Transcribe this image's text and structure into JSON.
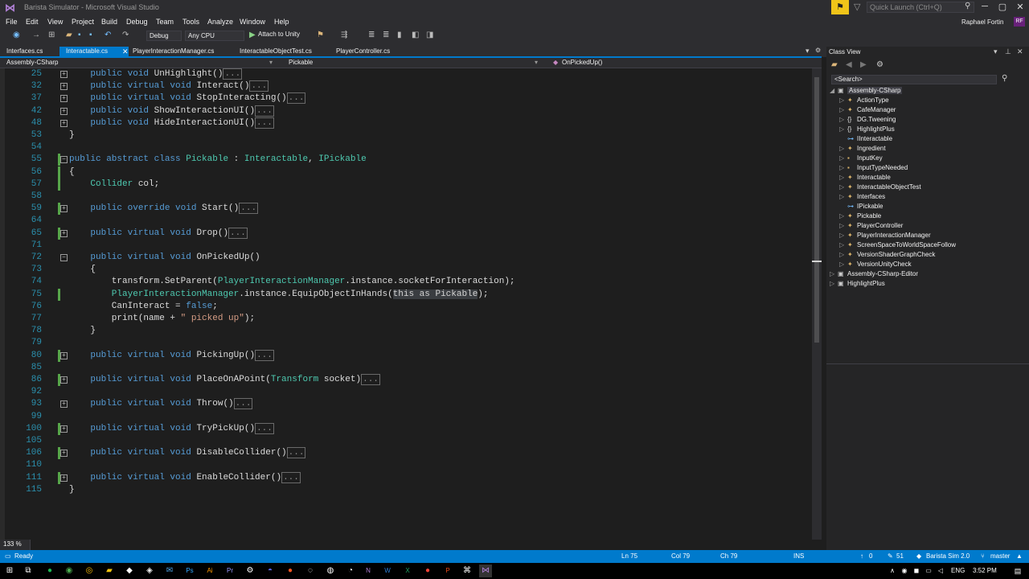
{
  "window": {
    "title": "Barista Simulator - Microsoft Visual Studio",
    "quick_launch_placeholder": "Quick Launch (Ctrl+Q)",
    "user": "Raphael Fortin",
    "avatar": "RF"
  },
  "menu": [
    "File",
    "Edit",
    "View",
    "Project",
    "Build",
    "Debug",
    "Team",
    "Tools",
    "Analyze",
    "Window",
    "Help"
  ],
  "toolbar": {
    "config": "Debug",
    "platform": "Any CPU",
    "attach": "Attach to Unity"
  },
  "tabs": [
    "Interfaces.cs",
    "Interactable.cs",
    "PlayerInteractionManager.cs",
    "InteractableObjectTest.cs",
    "PlayerController.cs"
  ],
  "nav": {
    "project": "Assembly-CSharp",
    "class": "Pickable",
    "member": "OnPickedUp()"
  },
  "code": [
    {
      "n": "25",
      "fold": true,
      "chg": "",
      "tokens": [
        [
          "k",
          "    public void "
        ],
        [
          "p",
          "UnHighlight()"
        ],
        [
          "col",
          "..."
        ]
      ]
    },
    {
      "n": "32",
      "fold": true,
      "chg": "",
      "tokens": [
        [
          "k",
          "    public virtual void "
        ],
        [
          "p",
          "Interact()"
        ],
        [
          "col",
          "..."
        ]
      ]
    },
    {
      "n": "37",
      "fold": true,
      "chg": "",
      "tokens": [
        [
          "k",
          "    public virtual void "
        ],
        [
          "p",
          "StopInteracting()"
        ],
        [
          "col",
          "..."
        ]
      ]
    },
    {
      "n": "42",
      "fold": true,
      "chg": "",
      "tokens": [
        [
          "k",
          "    public void "
        ],
        [
          "p",
          "ShowInteractionUI()"
        ],
        [
          "col",
          "..."
        ]
      ]
    },
    {
      "n": "48",
      "fold": true,
      "chg": "",
      "tokens": [
        [
          "k",
          "    public void "
        ],
        [
          "p",
          "HideInteractionUI()"
        ],
        [
          "col",
          "..."
        ]
      ]
    },
    {
      "n": "53",
      "fold": false,
      "chg": "",
      "tokens": [
        [
          "p",
          "}"
        ]
      ]
    },
    {
      "n": "54",
      "fold": false,
      "chg": "",
      "tokens": []
    },
    {
      "n": "55",
      "fold": true,
      "chg": "g",
      "tokens": [
        [
          "k",
          "public abstract class "
        ],
        [
          "t",
          "Pickable"
        ],
        [
          "p",
          " : "
        ],
        [
          "t",
          "Interactable"
        ],
        [
          "p",
          ", "
        ],
        [
          "t",
          "IPickable"
        ]
      ]
    },
    {
      "n": "56",
      "fold": false,
      "chg": "g",
      "tokens": [
        [
          "p",
          "{"
        ]
      ]
    },
    {
      "n": "57",
      "fold": false,
      "chg": "g",
      "tokens": [
        [
          "t",
          "    Collider"
        ],
        [
          "p",
          " col;"
        ]
      ]
    },
    {
      "n": "58",
      "fold": false,
      "chg": "",
      "tokens": []
    },
    {
      "n": "59",
      "fold": true,
      "chg": "g",
      "tokens": [
        [
          "k",
          "    public override void "
        ],
        [
          "p",
          "Start()"
        ],
        [
          "col",
          "..."
        ]
      ]
    },
    {
      "n": "64",
      "fold": false,
      "chg": "",
      "tokens": []
    },
    {
      "n": "65",
      "fold": true,
      "chg": "g",
      "tokens": [
        [
          "k",
          "    public virtual void "
        ],
        [
          "p",
          "Drop()"
        ],
        [
          "col",
          "..."
        ]
      ]
    },
    {
      "n": "71",
      "fold": false,
      "chg": "",
      "tokens": []
    },
    {
      "n": "72",
      "fold": true,
      "chg": "",
      "tokens": [
        [
          "k",
          "    public virtual void "
        ],
        [
          "p",
          "OnPickedUp()"
        ]
      ]
    },
    {
      "n": "73",
      "fold": false,
      "chg": "",
      "tokens": [
        [
          "p",
          "    {"
        ]
      ]
    },
    {
      "n": "74",
      "fold": false,
      "chg": "",
      "tokens": [
        [
          "p",
          "        transform.SetParent("
        ],
        [
          "t",
          "PlayerInteractionManager"
        ],
        [
          "p",
          ".instance.socketForInteraction);"
        ]
      ]
    },
    {
      "n": "75",
      "fold": false,
      "chg": "g",
      "tokens": [
        [
          "t",
          "        PlayerInteractionManager"
        ],
        [
          "p",
          ".instance.EquipObjectInHands("
        ],
        [
          "sel",
          "this as Pickable"
        ],
        [
          "p",
          ");"
        ]
      ]
    },
    {
      "n": "76",
      "fold": false,
      "chg": "",
      "tokens": [
        [
          "p",
          "        CanInteract = "
        ],
        [
          "k",
          "false"
        ],
        [
          "p",
          ";"
        ]
      ]
    },
    {
      "n": "77",
      "fold": false,
      "chg": "",
      "tokens": [
        [
          "p",
          "        print(name + "
        ],
        [
          "s",
          "\" picked up\""
        ],
        [
          "p",
          ");"
        ]
      ]
    },
    {
      "n": "78",
      "fold": false,
      "chg": "",
      "tokens": [
        [
          "p",
          "    }"
        ]
      ]
    },
    {
      "n": "79",
      "fold": false,
      "chg": "",
      "tokens": []
    },
    {
      "n": "80",
      "fold": true,
      "chg": "g",
      "tokens": [
        [
          "k",
          "    public virtual void "
        ],
        [
          "p",
          "PickingUp()"
        ],
        [
          "col",
          "..."
        ]
      ]
    },
    {
      "n": "85",
      "fold": false,
      "chg": "",
      "tokens": []
    },
    {
      "n": "86",
      "fold": true,
      "chg": "g",
      "tokens": [
        [
          "k",
          "    public virtual void "
        ],
        [
          "p",
          "PlaceOnAPoint("
        ],
        [
          "t",
          "Transform"
        ],
        [
          "p",
          " socket)"
        ],
        [
          "col",
          "..."
        ]
      ]
    },
    {
      "n": "92",
      "fold": false,
      "chg": "",
      "tokens": []
    },
    {
      "n": "93",
      "fold": true,
      "chg": "",
      "tokens": [
        [
          "k",
          "    public virtual void "
        ],
        [
          "p",
          "Throw()"
        ],
        [
          "col",
          "..."
        ]
      ]
    },
    {
      "n": "99",
      "fold": false,
      "chg": "",
      "tokens": []
    },
    {
      "n": "100",
      "fold": true,
      "chg": "g",
      "tokens": [
        [
          "k",
          "    public virtual void "
        ],
        [
          "p",
          "TryPickUp()"
        ],
        [
          "col",
          "..."
        ]
      ]
    },
    {
      "n": "105",
      "fold": false,
      "chg": "",
      "tokens": []
    },
    {
      "n": "106",
      "fold": true,
      "chg": "g",
      "tokens": [
        [
          "k",
          "    public virtual void "
        ],
        [
          "p",
          "DisableCollider()"
        ],
        [
          "col",
          "..."
        ]
      ]
    },
    {
      "n": "110",
      "fold": false,
      "chg": "",
      "tokens": []
    },
    {
      "n": "111",
      "fold": true,
      "chg": "g",
      "tokens": [
        [
          "k",
          "    public virtual void "
        ],
        [
          "p",
          "EnableCollider()"
        ],
        [
          "col",
          "..."
        ]
      ]
    },
    {
      "n": "115",
      "fold": false,
      "chg": "",
      "tokens": [
        [
          "p",
          "}"
        ]
      ]
    }
  ],
  "class_view": {
    "title": "Class View",
    "search_placeholder": "<Search>",
    "items": [
      {
        "label": "Assembly-CSharp",
        "depth": 0,
        "ex": "◢",
        "ic": "▣"
      },
      {
        "label": "ActionType",
        "depth": 1,
        "ex": "▷",
        "ic": "✦"
      },
      {
        "label": "CafeManager",
        "depth": 1,
        "ex": "▷",
        "ic": "✦"
      },
      {
        "label": "DG.Tweening",
        "depth": 1,
        "ex": "▷",
        "ic": "{}"
      },
      {
        "label": "HighlightPlus",
        "depth": 1,
        "ex": "▷",
        "ic": "{}"
      },
      {
        "label": "IInteractable",
        "depth": 1,
        "ex": "",
        "ic": "⊶"
      },
      {
        "label": "Ingredient",
        "depth": 1,
        "ex": "▷",
        "ic": "✦"
      },
      {
        "label": "InputKey",
        "depth": 1,
        "ex": "▷",
        "ic": "▪"
      },
      {
        "label": "InputTypeNeeded",
        "depth": 1,
        "ex": "▷",
        "ic": "▪"
      },
      {
        "label": "Interactable",
        "depth": 1,
        "ex": "▷",
        "ic": "✦"
      },
      {
        "label": "InteractableObjectTest",
        "depth": 1,
        "ex": "▷",
        "ic": "✦"
      },
      {
        "label": "Interfaces",
        "depth": 1,
        "ex": "▷",
        "ic": "✦"
      },
      {
        "label": "IPickable",
        "depth": 1,
        "ex": "",
        "ic": "⊶"
      },
      {
        "label": "Pickable",
        "depth": 1,
        "ex": "▷",
        "ic": "✦"
      },
      {
        "label": "PlayerController",
        "depth": 1,
        "ex": "▷",
        "ic": "✦"
      },
      {
        "label": "PlayerInteractionManager",
        "depth": 1,
        "ex": "▷",
        "ic": "✦"
      },
      {
        "label": "ScreenSpaceToWorldSpaceFollow",
        "depth": 1,
        "ex": "▷",
        "ic": "✦"
      },
      {
        "label": "VersionShaderGraphCheck",
        "depth": 1,
        "ex": "▷",
        "ic": "✦"
      },
      {
        "label": "VersionUnityCheck",
        "depth": 1,
        "ex": "▷",
        "ic": "✦"
      },
      {
        "label": "Assembly-CSharp-Editor",
        "depth": 0,
        "ex": "▷",
        "ic": "▣"
      },
      {
        "label": "HighlightPlus",
        "depth": 0,
        "ex": "▷",
        "ic": "▣"
      }
    ]
  },
  "status": {
    "ready": "Ready",
    "ln": "Ln 75",
    "col": "Col 79",
    "ch": "Ch 79",
    "ins": "INS",
    "up": "0",
    "pencil": "51",
    "repo": "Barista Sim 2.0",
    "branch": "master",
    "zoom": "133 %"
  },
  "taskbar": {
    "lang": "ENG",
    "time": "3:52 PM"
  }
}
